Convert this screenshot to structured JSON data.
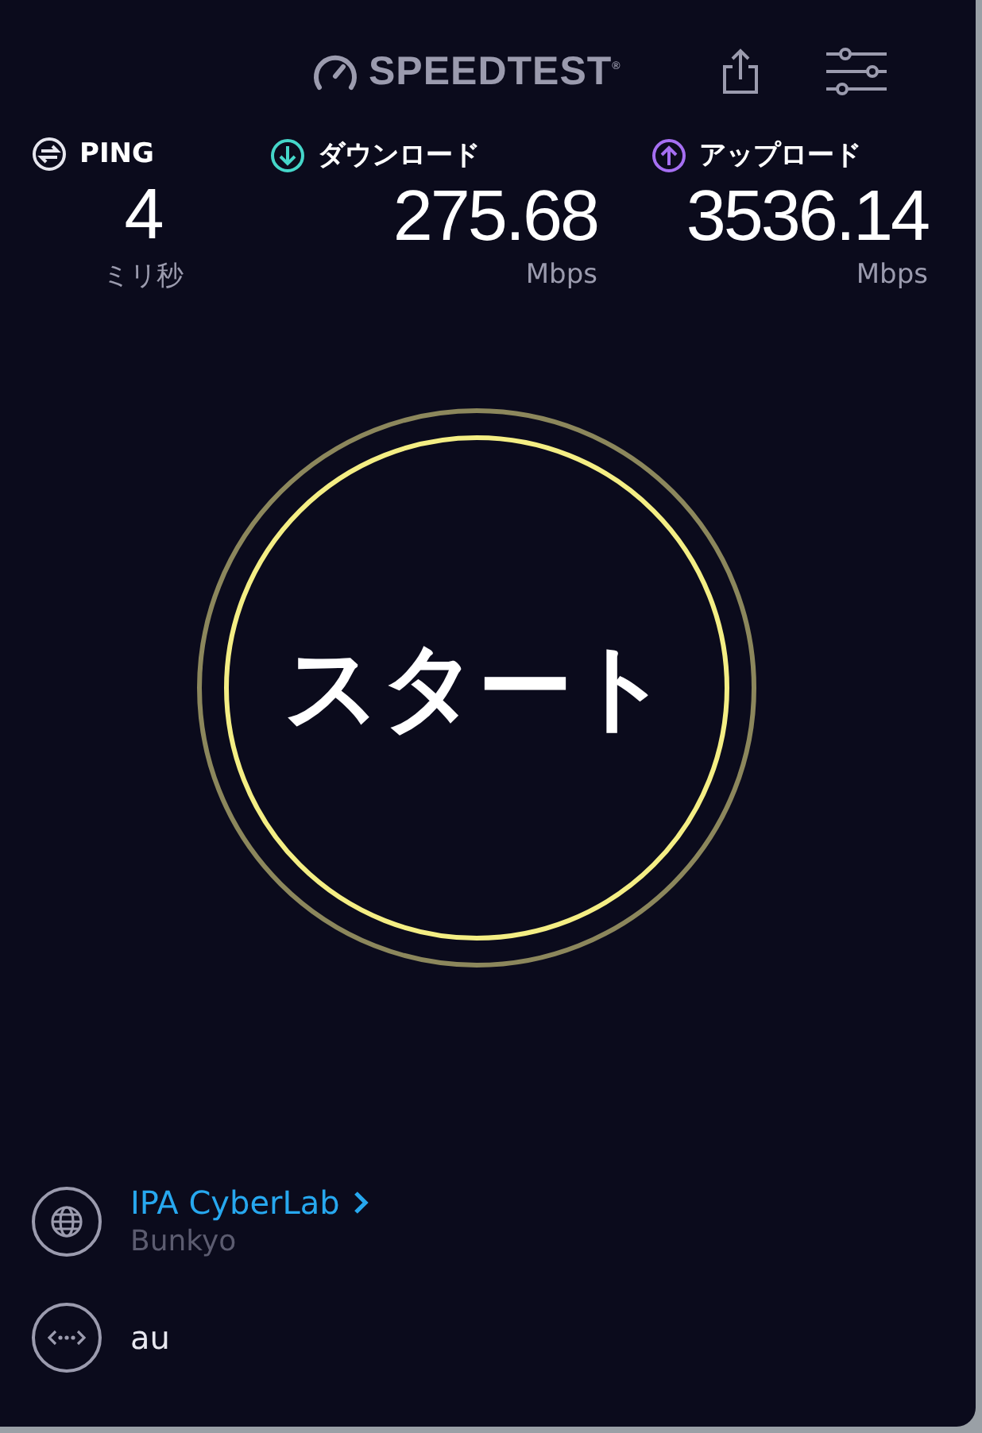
{
  "header": {
    "logo": "SPEEDTEST$^{®}$"
  },
  "metrics": [
    {
      "kind": "ping",
      "label": "PING",
      "value": "4",
      "unit": "ミリ秒"
    },
    {
      "kind": "download",
      "label": "ダウンロード",
      "value": "275.68",
      "unit": "Mbps"
    },
    {
      "kind": "upload",
      "label": "アップロード",
      "value": "3536.14",
      "unit": "Mbps"
    }
  ],
  "start_button": {
    "label": "スタート"
  },
  "server": {
    "name": "IPA CyberLab",
    "location": "Bunkyo"
  },
  "provider": {
    "name": "au"
  }
}
